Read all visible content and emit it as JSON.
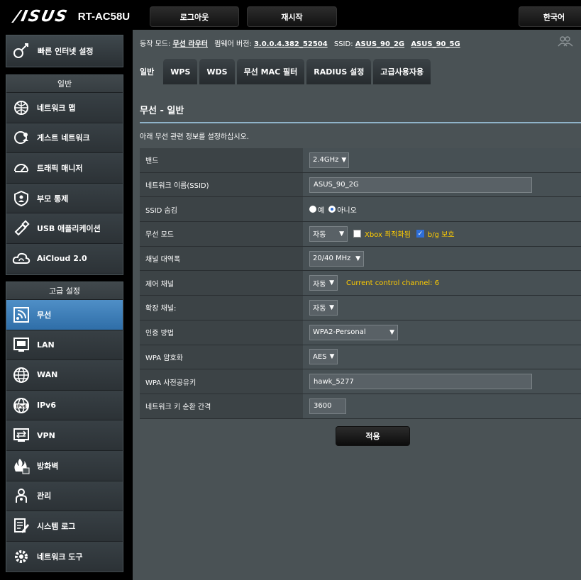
{
  "header": {
    "brand": "/ISUS",
    "model": "RT-AC58U",
    "logout": "로그아웃",
    "reboot": "재시작",
    "language": "한국어"
  },
  "sidebar": {
    "quick_setup": "빠른 인터넷 설정",
    "general_title": "일반",
    "general_items": [
      {
        "label": "네트워크 맵",
        "icon": "network-map-icon"
      },
      {
        "label": "게스트 네트워크",
        "icon": "guest-network-icon"
      },
      {
        "label": "트래픽 매니저",
        "icon": "traffic-manager-icon"
      },
      {
        "label": "부모 통제",
        "icon": "parental-control-icon"
      },
      {
        "label": "USB 애플리케이션",
        "icon": "usb-application-icon"
      },
      {
        "label": "AiCloud 2.0",
        "icon": "aicloud-icon"
      }
    ],
    "advanced_title": "고급 설정",
    "advanced_items": [
      {
        "label": "무선",
        "icon": "wireless-icon"
      },
      {
        "label": "LAN",
        "icon": "lan-icon"
      },
      {
        "label": "WAN",
        "icon": "wan-icon"
      },
      {
        "label": "IPv6",
        "icon": "ipv6-icon"
      },
      {
        "label": "VPN",
        "icon": "vpn-icon"
      },
      {
        "label": "방화벽",
        "icon": "firewall-icon"
      },
      {
        "label": "관리",
        "icon": "administration-icon"
      },
      {
        "label": "시스템 로그",
        "icon": "system-log-icon"
      },
      {
        "label": "네트워크 도구",
        "icon": "network-tools-icon"
      }
    ]
  },
  "status": {
    "mode_label": "동작 모드:",
    "mode_value": "무선 라우터",
    "firmware_label": "펌웨어 버전:",
    "firmware_value": "3.0.0.4.382_52504",
    "ssid_label": "SSID:",
    "ssid_1": "ASUS_90_2G",
    "ssid_2": "ASUS_90_5G"
  },
  "tabs": [
    "일반",
    "WPS",
    "WDS",
    "무선 MAC 필터",
    "RADIUS 설정",
    "고급사용자용"
  ],
  "page": {
    "title": "무선 - 일반",
    "description": "아래 무선 관련 정보를 설정하십시오."
  },
  "form": {
    "band_label": "밴드",
    "band_value": "2.4GHz",
    "ssid_label": "네트워크 이름(SSID)",
    "ssid_value": "ASUS_90_2G",
    "hide_ssid_label": "SSID 숨김",
    "hide_yes": "예",
    "hide_no": "아니오",
    "mode_label": "무선 모드",
    "mode_value": "자동",
    "xbox_label": "Xbox 최적화됨",
    "bg_label": "b/g 보호",
    "bandwidth_label": "채널 대역폭",
    "bandwidth_value": "20/40 MHz",
    "control_label": "제어 채널",
    "control_value": "자동",
    "control_hint": "Current control channel: 6",
    "ext_label": "확장 채널:",
    "ext_value": "자동",
    "auth_label": "인증 방법",
    "auth_value": "WPA2-Personal",
    "enc_label": "WPA 암호화",
    "enc_value": "AES",
    "psk_label": "WPA 사전공유키",
    "psk_value": "hawk_5277",
    "rotation_label": "네트워크 키 순환 간격",
    "rotation_value": "3600"
  },
  "apply": "적용"
}
